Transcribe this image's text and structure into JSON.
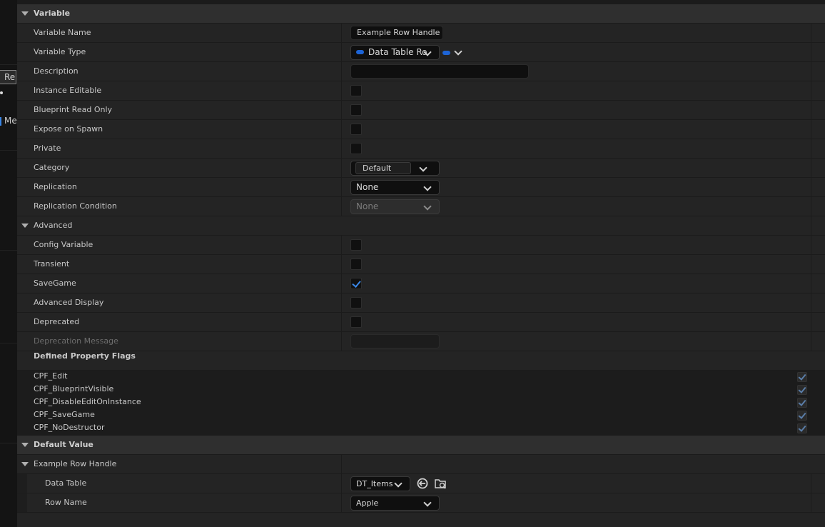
{
  "left_fragments": [
    "Re",
    "Me"
  ],
  "sections": {
    "variable": "Variable",
    "advanced": "Advanced",
    "default_value": "Default Value"
  },
  "variable": {
    "name_label": "Variable Name",
    "name_value": "Example Row Handle",
    "type_label": "Variable Type",
    "type_value": "Data Table Ro",
    "type_pill_color": "#1d64d6",
    "description_label": "Description",
    "description_value": "",
    "instance_editable_label": "Instance Editable",
    "blueprint_read_only_label": "Blueprint Read Only",
    "expose_on_spawn_label": "Expose on Spawn",
    "private_label": "Private",
    "category_label": "Category",
    "category_value": "Default",
    "replication_label": "Replication",
    "replication_value": "None",
    "replication_condition_label": "Replication Condition",
    "replication_condition_value": "None"
  },
  "advanced": {
    "config_variable_label": "Config Variable",
    "transient_label": "Transient",
    "savegame_label": "SaveGame",
    "savegame_checked": true,
    "advanced_display_label": "Advanced Display",
    "deprecated_label": "Deprecated",
    "deprecation_message_label": "Deprecation Message",
    "defined_flags_label": "Defined Property Flags",
    "flags": [
      "CPF_Edit",
      "CPF_BlueprintVisible",
      "CPF_DisableEditOnInstance",
      "CPF_SaveGame",
      "CPF_NoDestructor"
    ]
  },
  "default_value": {
    "struct_label": "Example Row Handle",
    "data_table_label": "Data Table",
    "data_table_value": "DT_Items",
    "row_name_label": "Row Name",
    "row_name_value": "Apple"
  },
  "icons": {
    "browse": "arrow-left-circle-icon",
    "find": "folder-search-icon"
  }
}
